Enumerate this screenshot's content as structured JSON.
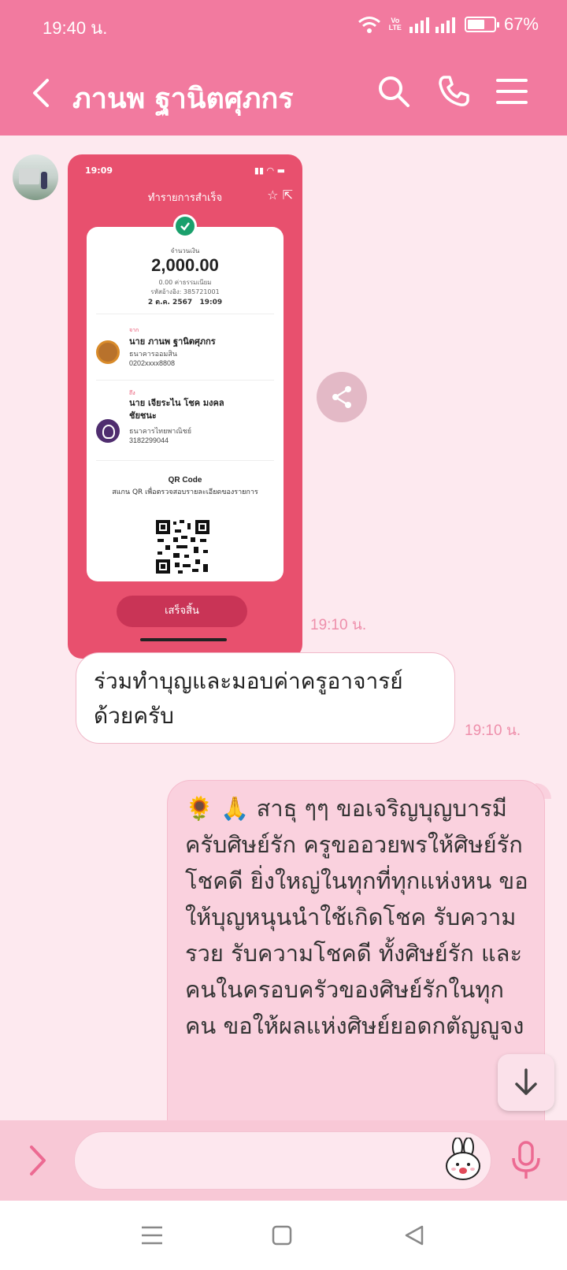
{
  "status_bar": {
    "time": "19:40 น.",
    "network": "VoLTE",
    "battery_percent": "67%",
    "battery_level": 0.67
  },
  "header": {
    "title": "ภานพ ฐานิตศุภกร",
    "icons": [
      "back-icon",
      "search-icon",
      "phone-icon",
      "menu-icon"
    ]
  },
  "messages": [
    {
      "type": "image",
      "direction": "incoming",
      "time": "19:10 น.",
      "receipt": {
        "status_time": "19:09",
        "header_title": "ทำรายการสำเร็จ",
        "amount_label": "จำนวนเงิน",
        "amount": "2,000.00",
        "fee": "0.00 ค่าธรรมเนียม",
        "reference": "รหัสอ้างอิง: 385721001",
        "date": "2 ต.ค. 2567",
        "time": "19:09",
        "from_label": "จาก",
        "from_name": "นาย ภานพ ฐานิตศุภกร",
        "from_bank": "ธนาคารออมสิน",
        "from_account": "0202xxxx8808",
        "to_label": "ถึง",
        "to_name": "นาย เจียระไน โชค มงคลชัยชนะ",
        "to_bank": "ธนาคารไทยพาณิชย์",
        "to_account": "3182299044",
        "qr_title": "QR Code",
        "qr_desc": "สแกน QR เพื่อตรวจสอบรายละเอียดของรายการ",
        "done_button": "เสร็จสิ้น"
      }
    },
    {
      "type": "text",
      "direction": "incoming",
      "text": "ร่วมทำบุญและมอบค่าครูอาจารย์ด้วยครับ",
      "time": "19:10 น."
    },
    {
      "type": "text",
      "direction": "outgoing",
      "text": "🌻 🙏 สาธุ ๆๆ ขอเจริญบุญบารมีครับศิษย์รัก ครูขออวยพรให้ศิษย์รักโชคดี ยิ่งใหญ่ในทุกที่ทุกแห่งหน ขอให้บุญหนุนนำใช้เกิดโชค รับความรวย รับความโชคดี ทั้งศิษย์รัก และคนในครอบครัวของศิษย์รักในทุกคน ขอให้ผลแห่งศิษย์ยอดกตัญญูจง"
    }
  ],
  "colors": {
    "accent": "#f27a9f",
    "background": "#fde9ef",
    "outgoing_bubble": "#fad1de",
    "timestamp": "#ee8fab"
  }
}
